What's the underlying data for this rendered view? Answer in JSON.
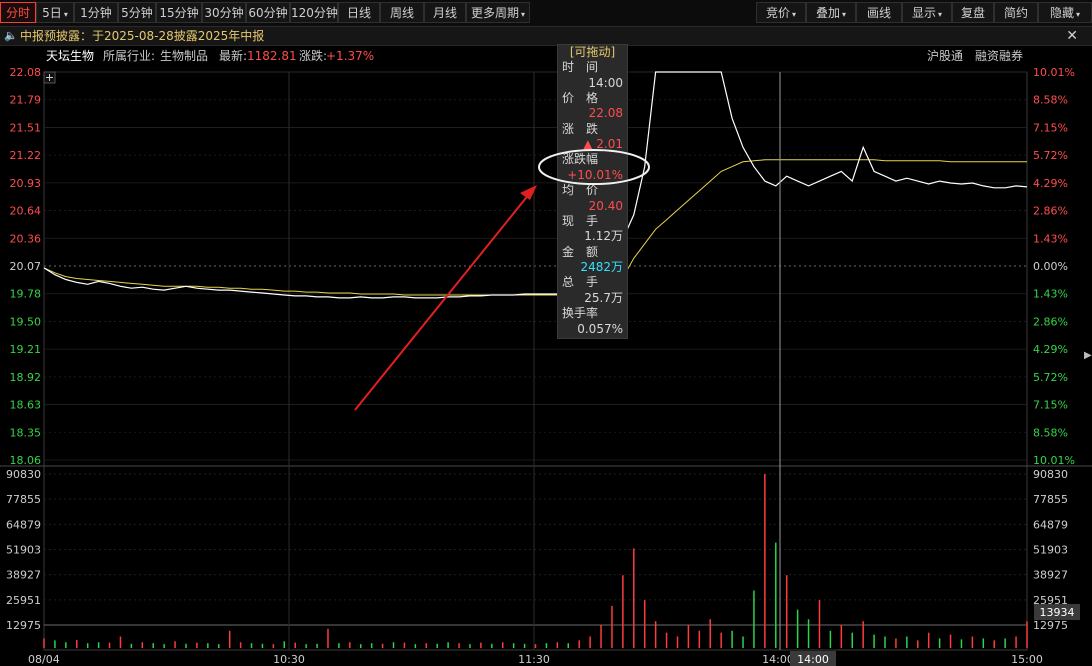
{
  "toolbar": {
    "left_tabs": [
      "分时",
      "5日",
      "1分钟",
      "5分钟",
      "15分钟",
      "30分钟",
      "60分钟",
      "120分钟",
      "日线",
      "周线",
      "月线",
      "更多周期"
    ],
    "right_tabs": [
      "竞价",
      "叠加",
      "画线",
      "显示",
      "复盘",
      "简约",
      "隐藏"
    ]
  },
  "notice": {
    "text": "中报预披露：于2025-08-28披露2025年中报",
    "close": "✕"
  },
  "info": {
    "name": "天坛生物",
    "industry_label": "所属行业:",
    "industry": "生物制品",
    "latest_label": "最新:",
    "latest": "1182.81",
    "change_label": "涨跌:",
    "change": "+1.37%",
    "links": [
      "沪股通",
      "融资融券"
    ]
  },
  "tooltip": {
    "header": "[可拖动]",
    "time_label": "时　间",
    "time": "14:00",
    "price_label": "价　格",
    "price": "22.08",
    "change_label": "涨　跌",
    "change": "▲ 2.01",
    "pct_label": "涨跌幅",
    "pct": "+10.01%",
    "avg_label": "均　价",
    "avg": "20.40",
    "vol_now_label": "现　手",
    "vol_now": "1.12万",
    "amount_label": "金　额",
    "amount": "2482万",
    "total_label": "总　手",
    "total": "25.7万",
    "turnover_label": "换手率",
    "turnover": "0.057%"
  },
  "colors": {
    "up": "#ff3b3b",
    "down": "#2bd44a",
    "price_line": "#ffffff",
    "avg_line": "#e8d44a",
    "grid": "#2a2a2a"
  },
  "chart_data": {
    "type": "line",
    "price_axis": [
      "22.08",
      "21.79",
      "21.51",
      "21.22",
      "20.93",
      "20.64",
      "20.36",
      "20.07",
      "19.78",
      "19.50",
      "19.21",
      "18.92",
      "18.63",
      "18.35",
      "18.06"
    ],
    "pct_axis": [
      "10.01%",
      "8.58%",
      "7.15%",
      "5.72%",
      "4.29%",
      "2.86%",
      "1.43%",
      "0.00%",
      "1.43%",
      "2.86%",
      "4.29%",
      "5.72%",
      "7.15%",
      "8.58%",
      "10.01%"
    ],
    "volume_axis": [
      "90830",
      "77855",
      "64879",
      "51903",
      "38927",
      "25951",
      "12975"
    ],
    "volume_badge": "13934",
    "time_labels": [
      "08/04",
      "10:30",
      "11:30",
      "14:00",
      "15:00"
    ],
    "cursor_time": "14:00",
    "prev_close": 20.07,
    "ylim": [
      18.06,
      22.08
    ],
    "vol_max": 90830,
    "price": [
      20.05,
      19.98,
      19.93,
      19.9,
      19.88,
      19.91,
      19.89,
      19.86,
      19.84,
      19.85,
      19.83,
      19.82,
      19.84,
      19.86,
      19.84,
      19.83,
      19.82,
      19.82,
      19.81,
      19.8,
      19.79,
      19.78,
      19.77,
      19.76,
      19.76,
      19.75,
      19.75,
      19.74,
      19.74,
      19.75,
      19.74,
      19.74,
      19.75,
      19.75,
      19.74,
      19.74,
      19.74,
      19.75,
      19.75,
      19.76,
      19.76,
      19.77,
      19.77,
      19.77,
      19.78,
      19.78,
      19.78,
      19.78,
      19.79,
      19.79,
      19.8,
      19.85,
      20.1,
      20.35,
      20.6,
      21.1,
      22.08,
      22.08,
      22.08,
      22.08,
      22.08,
      22.08,
      22.08,
      21.6,
      21.3,
      21.1,
      20.95,
      20.9,
      21.0,
      20.95,
      20.9,
      20.95,
      21.0,
      21.05,
      20.95,
      21.3,
      21.05,
      21.0,
      20.95,
      20.98,
      20.95,
      20.92,
      20.95,
      20.93,
      20.92,
      20.93,
      20.9,
      20.88,
      20.88,
      20.9,
      20.89
    ],
    "avg": [
      20.05,
      20.0,
      19.96,
      19.94,
      19.93,
      19.92,
      19.91,
      19.9,
      19.89,
      19.88,
      19.87,
      19.86,
      19.86,
      19.86,
      19.86,
      19.85,
      19.85,
      19.84,
      19.84,
      19.83,
      19.83,
      19.82,
      19.81,
      19.81,
      19.8,
      19.8,
      19.79,
      19.79,
      19.79,
      19.78,
      19.78,
      19.78,
      19.78,
      19.77,
      19.77,
      19.77,
      19.77,
      19.77,
      19.77,
      19.77,
      19.77,
      19.77,
      19.77,
      19.77,
      19.77,
      19.77,
      19.77,
      19.77,
      19.78,
      19.78,
      19.78,
      19.8,
      19.85,
      19.95,
      20.15,
      20.3,
      20.45,
      20.55,
      20.65,
      20.75,
      20.85,
      20.95,
      21.05,
      21.1,
      21.15,
      21.16,
      21.17,
      21.17,
      21.17,
      21.17,
      21.17,
      21.17,
      21.17,
      21.17,
      21.17,
      21.17,
      21.17,
      21.16,
      21.16,
      21.16,
      21.16,
      21.16,
      21.16,
      21.15,
      21.15,
      21.15,
      21.15,
      21.15,
      21.15,
      21.15,
      21.15
    ],
    "volume": [
      5000,
      4000,
      3000,
      4200,
      2500,
      3000,
      2800,
      6000,
      2200,
      3000,
      2500,
      2000,
      3500,
      2200,
      2800,
      2500,
      2000,
      9000,
      3000,
      2500,
      2200,
      2000,
      3500,
      2800,
      2000,
      2200,
      10000,
      2500,
      3000,
      2000,
      2500,
      2200,
      3000,
      2800,
      2000,
      2500,
      2200,
      3000,
      2500,
      2000,
      2800,
      2200,
      3000,
      2500,
      2200,
      2000,
      2500,
      3000,
      2500,
      4000,
      6000,
      12000,
      22000,
      38000,
      52000,
      25000,
      14000,
      8000,
      6000,
      12000,
      9000,
      15000,
      8000,
      9000,
      6000,
      30000,
      90830,
      55000,
      38000,
      20000,
      15000,
      25000,
      9000,
      12000,
      8000,
      14000,
      7000,
      6000,
      5000,
      6000,
      4000,
      8000,
      5000,
      7000,
      4500,
      6000,
      5000,
      4000,
      5000,
      6000,
      13934
    ],
    "volume_up": [
      true,
      false,
      false,
      true,
      false,
      false,
      true,
      true,
      false,
      true,
      false,
      false,
      true,
      false,
      true,
      false,
      false,
      true,
      true,
      false,
      false,
      true,
      false,
      true,
      false,
      false,
      true,
      false,
      true,
      false,
      false,
      true,
      false,
      true,
      false,
      true,
      false,
      false,
      true,
      false,
      true,
      false,
      true,
      false,
      false,
      true,
      false,
      true,
      false,
      true,
      true,
      true,
      true,
      true,
      true,
      true,
      true,
      true,
      true,
      true,
      true,
      true,
      true,
      false,
      false,
      false,
      true,
      false,
      true,
      false,
      false,
      true,
      false,
      true,
      false,
      true,
      false,
      false,
      true,
      false,
      true,
      true,
      false,
      true,
      false,
      true,
      false,
      true,
      false,
      true,
      true
    ]
  }
}
